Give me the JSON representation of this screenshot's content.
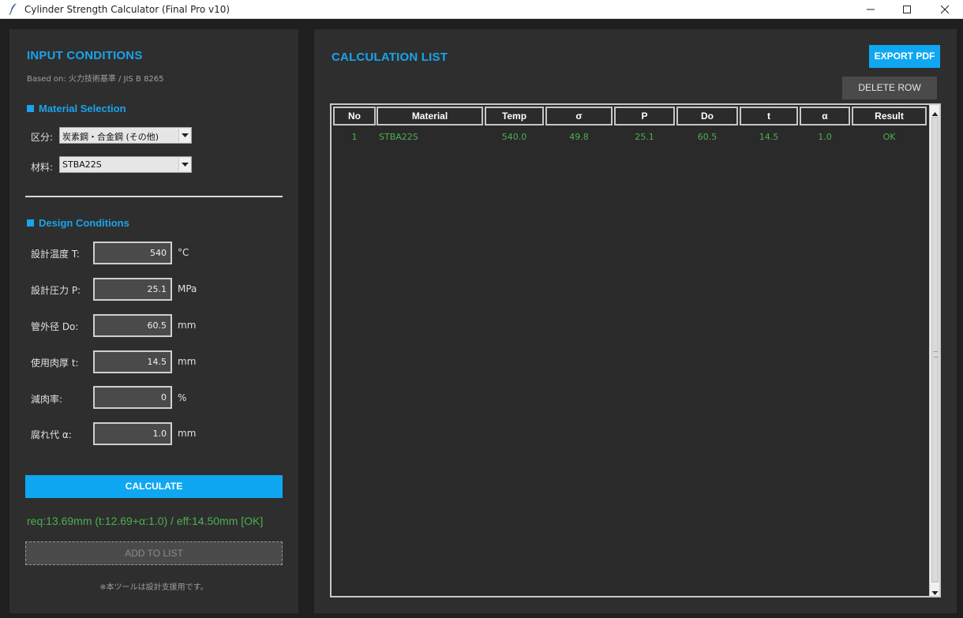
{
  "window": {
    "title": "Cylinder Strength Calculator (Final Pro v10)"
  },
  "left": {
    "header": "INPUT CONDITIONS",
    "based_on": "Based on: 火力技術基準 / JIS B 8265",
    "material_section": "Material Selection",
    "category_label": "区分:",
    "category_value": "炭素鋼・合金鋼 (その他)",
    "material_label": "材料:",
    "material_value": "STBA22S",
    "design_section": "Design Conditions",
    "fields": [
      {
        "label": "設計温度 T:",
        "value": "540",
        "unit": "°C"
      },
      {
        "label": "設計圧力 P:",
        "value": "25.1",
        "unit": "MPa"
      },
      {
        "label": "管外径 Do:",
        "value": "60.5",
        "unit": "mm"
      },
      {
        "label": "使用肉厚 t:",
        "value": "14.5",
        "unit": "mm"
      },
      {
        "label": "減肉率:",
        "value": "0",
        "unit": "%"
      },
      {
        "label": "腐れ代 α:",
        "value": "1.0",
        "unit": "mm"
      }
    ],
    "calculate_label": "CALCULATE",
    "result": "req:13.69mm (t:12.69+α:1.0) / eff:14.50mm [OK]",
    "add_label": "ADD TO LIST",
    "note": "※本ツールは設計支援用です。"
  },
  "right": {
    "header": "CALCULATION LIST",
    "export_label": "EXPORT PDF",
    "delete_label": "DELETE ROW",
    "columns": [
      "No",
      "Material",
      "Temp",
      "σ",
      "P",
      "Do",
      "t",
      "α",
      "Result"
    ],
    "rows": [
      [
        "1",
        "STBA22S",
        "540.0",
        "49.8",
        "25.1",
        "60.5",
        "14.5",
        "1.0",
        "OK"
      ]
    ]
  },
  "colors": {
    "accent": "#19a4ec",
    "ok_green": "#4cb050",
    "panel": "#2e2e2e",
    "background": "#1f1f1f"
  },
  "icons": {
    "app": "feather-icon",
    "minimize": "minimize-icon",
    "maximize": "maximize-icon",
    "close": "close-icon",
    "dropdown": "chevron-down-icon"
  }
}
